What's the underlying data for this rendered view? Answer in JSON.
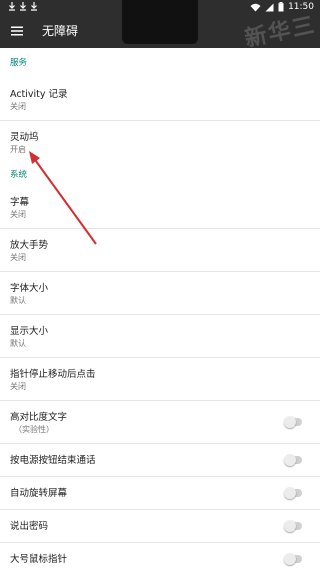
{
  "status_bar": {
    "time": "11:50",
    "icons_left": [
      "download-icon",
      "download-icon",
      "download-icon"
    ],
    "icons_right": [
      "wifi-icon",
      "signal-icon",
      "battery-icon"
    ]
  },
  "app_bar": {
    "title": "无障碍",
    "menu_icon": "hamburger-menu-icon",
    "watermark": "新华三"
  },
  "sections": {
    "services": {
      "header": "服务",
      "items": [
        {
          "title": "Activity 记录",
          "summary": "关闭"
        },
        {
          "title": "灵动坞",
          "summary": "开启"
        }
      ]
    },
    "system": {
      "header": "系统",
      "items": [
        {
          "title": "字幕",
          "summary": "关闭"
        },
        {
          "title": "放大手势",
          "summary": "关闭"
        },
        {
          "title": "字体大小",
          "summary": "默认"
        },
        {
          "title": "显示大小",
          "summary": "默认"
        },
        {
          "title": "指针停止移动后点击",
          "summary": "关闭"
        },
        {
          "title": "高对比度文字",
          "summary": "（实验性）",
          "toggle": false
        },
        {
          "title": "按电源按钮结束通话",
          "toggle": false
        },
        {
          "title": "自动旋转屏幕",
          "toggle": false
        },
        {
          "title": "说出密码",
          "toggle": false
        },
        {
          "title": "大号鼠标指针",
          "toggle": false
        }
      ]
    }
  },
  "colors": {
    "app_bar": "#2e2e2e",
    "section_header": "#00897b",
    "annotation_arrow": "#d32f2f"
  }
}
